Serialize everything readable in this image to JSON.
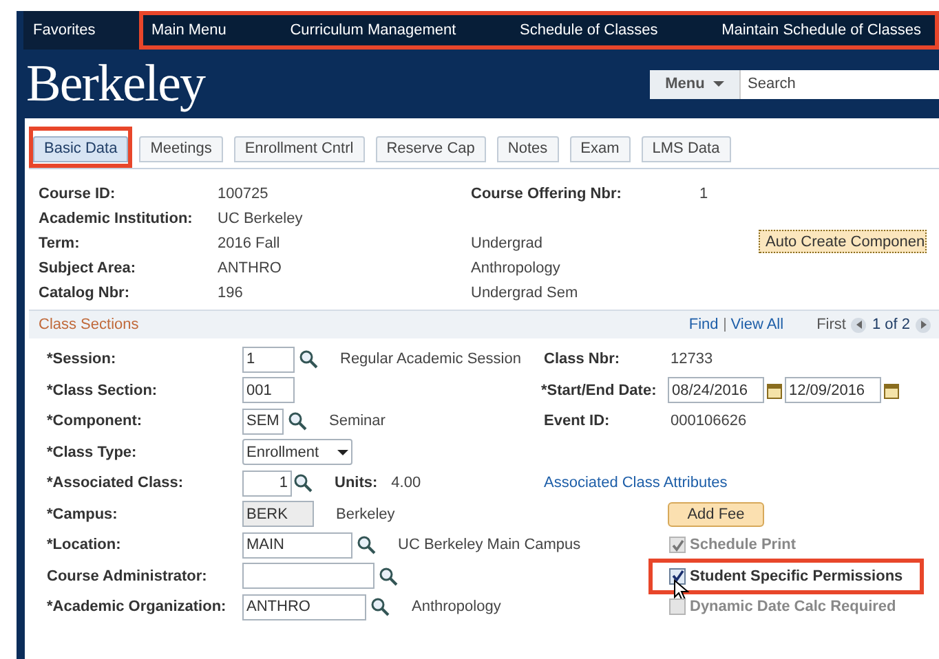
{
  "nav": {
    "favorites": "Favorites",
    "highlighted": true,
    "items": [
      "Main Menu",
      "Curriculum Management",
      "Schedule of Classes",
      "Maintain Schedule of Classes"
    ]
  },
  "header": {
    "logo": "Berkeley",
    "menu_button": "Menu",
    "search": {
      "placeholder": "Search"
    }
  },
  "tabs": [
    {
      "label": "Basic Data",
      "selected": true,
      "highlighted": true
    },
    {
      "label": "Meetings",
      "selected": false,
      "highlighted": false
    },
    {
      "label": "Enrollment Cntrl",
      "selected": false,
      "highlighted": false
    },
    {
      "label": "Reserve Cap",
      "selected": false,
      "highlighted": false
    },
    {
      "label": "Notes",
      "selected": false,
      "highlighted": false
    },
    {
      "label": "Exam",
      "selected": false,
      "highlighted": false
    },
    {
      "label": "LMS Data",
      "selected": false,
      "highlighted": false
    }
  ],
  "course_info": [
    {
      "label": "Course ID:",
      "value": "100725",
      "right_label": "Course Offering Nbr:",
      "right_value": "1"
    },
    {
      "label": "Academic Institution:",
      "value": "UC Berkeley"
    },
    {
      "label": "Term:",
      "value": "2016 Fall",
      "note": "Undergrad"
    },
    {
      "label": "Subject Area:",
      "value": "ANTHRO",
      "note": "Anthropology"
    },
    {
      "label": "Catalog Nbr:",
      "value": "196",
      "note": "Undergrad Sem"
    }
  ],
  "auto_create_button": "Auto Create Componen",
  "class_sections": {
    "title": "Class Sections",
    "find": "Find",
    "view_all": "View All",
    "first": "First",
    "position": "1 of 2",
    "rows": [
      {
        "label": "*Session:",
        "field": {
          "kind": "lookup",
          "value": "1"
        },
        "description": "Regular Academic Session",
        "right": {
          "kind": "text",
          "label": "Class Nbr:",
          "value": "12733"
        }
      },
      {
        "label": "*Class Section:",
        "field": {
          "kind": "text",
          "value": "001"
        },
        "right": {
          "kind": "dates",
          "label": "*Start/End Date:",
          "values": [
            "08/24/2016",
            "12/09/2016"
          ]
        }
      },
      {
        "label": "*Component:",
        "field": {
          "kind": "lookup",
          "value": "SEM"
        },
        "description": "Seminar",
        "right": {
          "kind": "text",
          "label": "Event ID:",
          "value": "000106626"
        }
      },
      {
        "label": "*Class Type:",
        "field": {
          "kind": "select",
          "value": "Enrollment"
        }
      },
      {
        "label": "*Associated Class:",
        "field": {
          "kind": "number",
          "value": "1"
        },
        "units_label": "Units:",
        "units_value": "4.00",
        "right": {
          "kind": "link",
          "label": "Associated Class Attributes"
        }
      },
      {
        "label": "*Campus:",
        "field": {
          "kind": "readonly",
          "value": "BERK"
        },
        "description": "Berkeley",
        "right": {
          "kind": "button",
          "label": "Add Fee"
        }
      },
      {
        "label": "*Location:",
        "field": {
          "kind": "lookup",
          "value": "MAIN"
        },
        "description": "UC Berkeley Main Campus",
        "right": {
          "kind": "checkbox",
          "label": "Schedule Print",
          "checked": true,
          "disabled": true,
          "highlighted": false
        }
      },
      {
        "label": "Course Administrator:",
        "field": {
          "kind": "lookup"
        },
        "right": {
          "kind": "checkbox",
          "label": "Student Specific Permissions",
          "checked": true,
          "disabled": false,
          "highlighted": true
        }
      },
      {
        "label": "*Academic Organization:",
        "field": {
          "kind": "lookup",
          "value": "ANTHRO"
        },
        "description": "Anthropology",
        "right": {
          "kind": "checkbox",
          "label": "Dynamic Date Calc Required",
          "checked": false,
          "disabled": true,
          "highlighted": false
        }
      }
    ]
  }
}
